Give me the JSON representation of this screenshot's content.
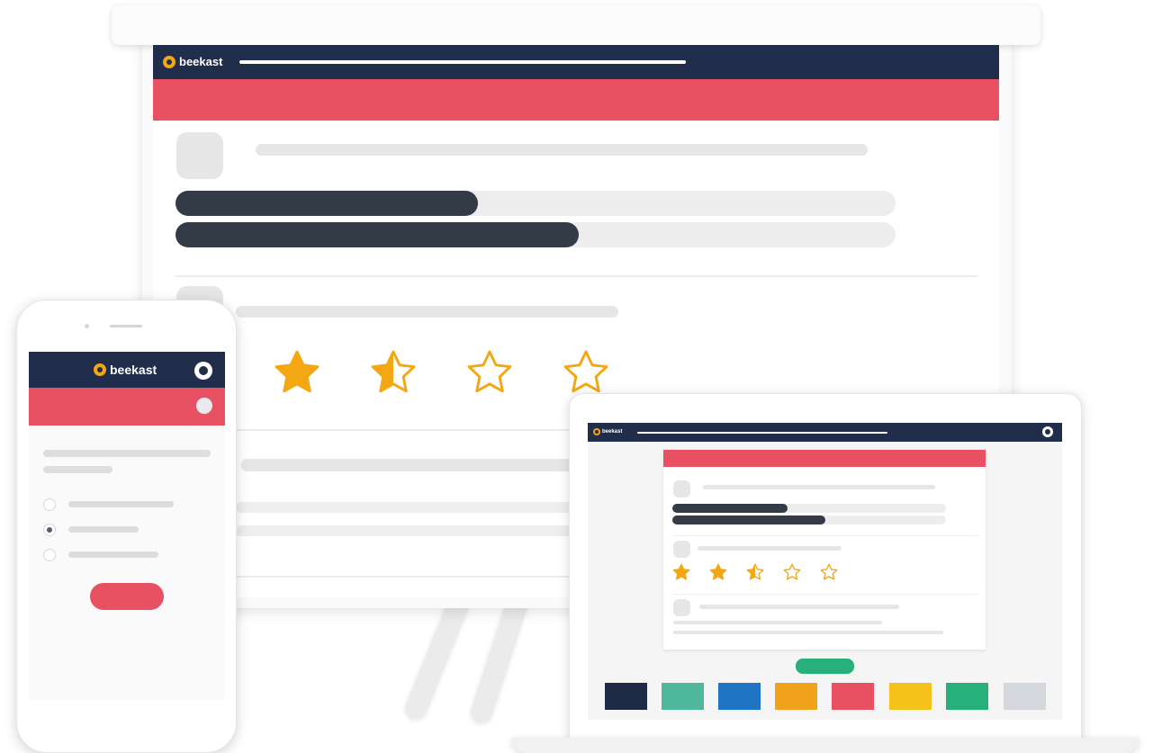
{
  "brand": {
    "name": "beekast",
    "colors": {
      "navy": "#202d4b",
      "coral": "#e85162",
      "gold": "#f3a712",
      "dark_bar": "#333b47",
      "green_button": "#27b07a"
    }
  },
  "projector": {
    "header_logo": "beekast",
    "poll_results": [
      {
        "share": 0.42
      },
      {
        "share": 0.56
      }
    ],
    "rating": {
      "value": 1.5,
      "max": 4
    }
  },
  "phone": {
    "header_logo": "beekast",
    "icons": [
      "user-icon",
      "toggle-icon"
    ],
    "options": [
      {
        "selected": false
      },
      {
        "selected": true
      },
      {
        "selected": false
      }
    ]
  },
  "laptop": {
    "header_logo": "beekast",
    "poll_results": [
      {
        "share": 0.42
      },
      {
        "share": 0.56
      }
    ],
    "rating": {
      "value": 2.5,
      "max": 5
    },
    "answer_colors": [
      "#1f2a44",
      "#4fb79a",
      "#1f74c3",
      "#f0a21a",
      "#e85162",
      "#f5c21c",
      "#27b07a",
      "#d4d8dc"
    ]
  }
}
